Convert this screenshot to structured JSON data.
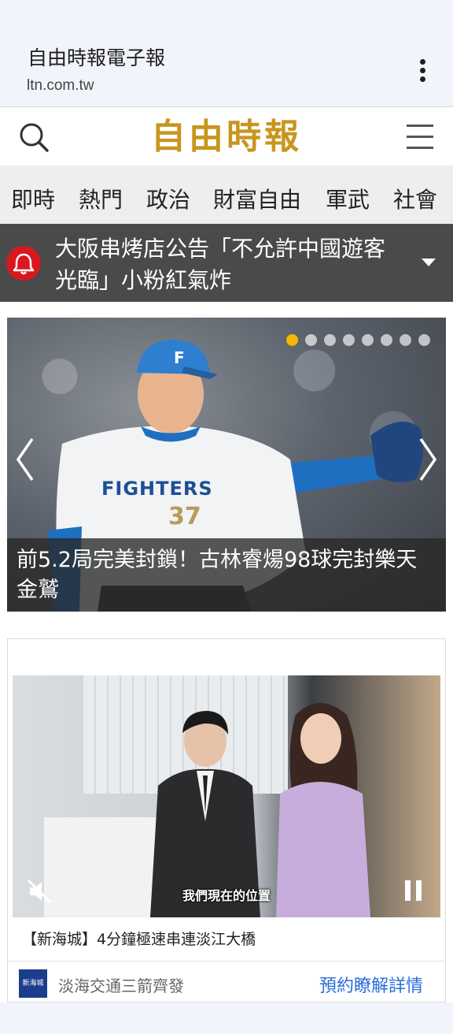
{
  "browser": {
    "title": "自由時報電子報",
    "url": "ltn.com.tw",
    "menu_icon": "more-vert-icon"
  },
  "header": {
    "logo_text": "自由時報",
    "search_icon": "search-icon",
    "menu_icon": "hamburger-menu-icon",
    "logo_color": "#c8961e"
  },
  "nav": {
    "items": [
      "即時",
      "熱門",
      "政治",
      "財富自由",
      "軍武",
      "社會"
    ]
  },
  "alert": {
    "text": "大阪串烤店公告「不允許中國遊客光臨」小粉紅氣炸",
    "icon": "bell-icon",
    "accent": "#d8181e"
  },
  "carousel": {
    "caption": "前5.2局完美封鎖！古林睿煬98球完封樂天金鷲",
    "slide_count": 8,
    "active_index": 0,
    "active_dot_color": "#f5b700",
    "jersey_text": "FIGHTERS",
    "jersey_number": "37",
    "cap_letter": "F"
  },
  "ad": {
    "video_subtitle": "我們現在的位置",
    "headline": "【新海城】4分鐘極速串連淡江大橋",
    "brand_logo_text": "新海城",
    "brand": "淡海交通三箭齊發",
    "cta": "預約瞭解詳情",
    "cta_color": "#2a6ed8"
  }
}
